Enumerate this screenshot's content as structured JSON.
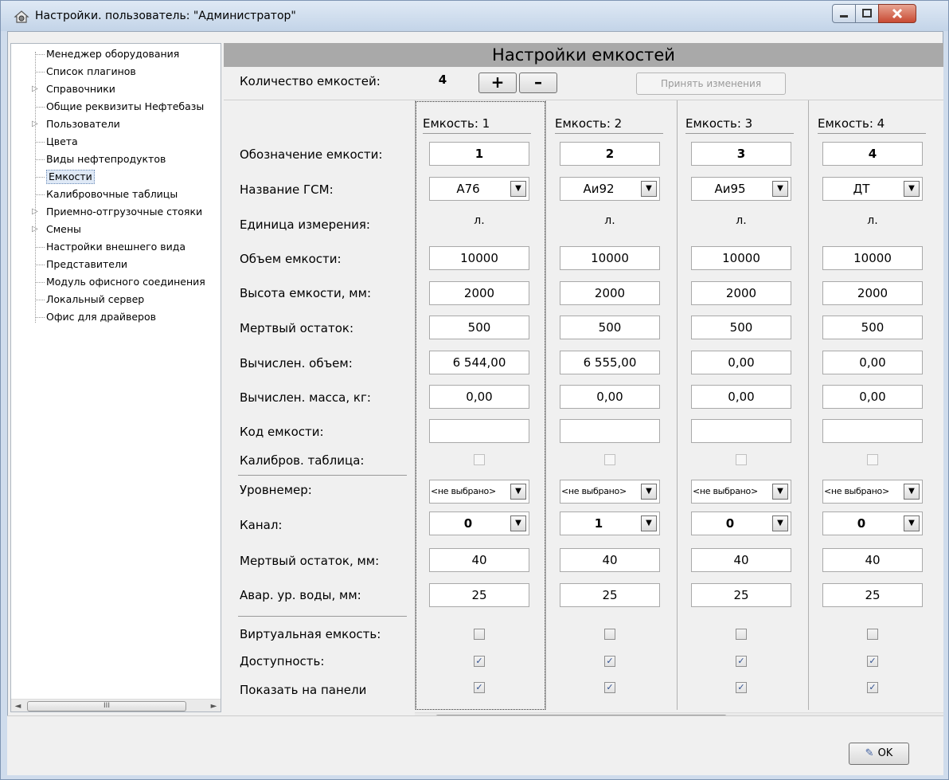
{
  "window": {
    "title": "Настройки. пользователь: \"Администратор\"",
    "app_icon": "house-gear-icon",
    "controls": {
      "minimize": "minimize-icon",
      "maximize": "maximize-icon",
      "close": "close-icon"
    }
  },
  "tree": {
    "items": [
      {
        "label": "Менеджер оборудования",
        "expandable": false
      },
      {
        "label": "Список плагинов",
        "expandable": false
      },
      {
        "label": "Справочники",
        "expandable": true
      },
      {
        "label": "Общие реквизиты Нефтебазы",
        "expandable": false
      },
      {
        "label": "Пользователи",
        "expandable": true
      },
      {
        "label": "Цвета",
        "expandable": false
      },
      {
        "label": "Виды нефтепродуктов",
        "expandable": false
      },
      {
        "label": "Емкости",
        "expandable": false,
        "selected": true
      },
      {
        "label": "Калибровочные таблицы",
        "expandable": false
      },
      {
        "label": "Приемно-отгрузочные стояки",
        "expandable": true
      },
      {
        "label": "Смены",
        "expandable": true
      },
      {
        "label": "Настройки внешнего вида",
        "expandable": false
      },
      {
        "label": "Представители",
        "expandable": false
      },
      {
        "label": "Модуль офисного соединения",
        "expandable": false
      },
      {
        "label": "Локальный сервер",
        "expandable": false
      },
      {
        "label": "Офис для драйверов",
        "expandable": false
      }
    ]
  },
  "panel": {
    "title": "Настройки емкостей",
    "count_label": "Количество емкостей:",
    "count_value": "4",
    "plus_label": "+",
    "minus_label": "–",
    "apply_label": "Принять изменения"
  },
  "labels": {
    "designation": "Обозначение емкости:",
    "fuel_name": "Название ГСМ:",
    "unit": "Единица измерения:",
    "volume": "Объем емкости:",
    "height": "Высота емкости, мм:",
    "dead_rest": "Мертвый остаток:",
    "calc_volume": "Вычислен. объем:",
    "calc_mass": "Вычислен. масса, кг:",
    "code": "Код емкости:",
    "calib_table": "Калибров. таблица:",
    "level_gauge": "Уровнемер:",
    "channel": "Канал:",
    "dead_rest_mm": "Мертвый остаток, мм:",
    "alarm_water": "Авар. ур. воды, мм:",
    "virtual": "Виртуальная емкость:",
    "available": "Доступность:",
    "show_panel": "Показать на панели"
  },
  "tanks": [
    {
      "header": "Емкость: 1",
      "designation": "1",
      "fuel": "А76",
      "unit": "л.",
      "volume": "10000",
      "height": "2000",
      "dead_rest": "500",
      "calc_volume": "6 544,00",
      "calc_mass": "0,00",
      "code": "",
      "calib": false,
      "gauge": "<не выбрано>",
      "channel": "0",
      "dead_rest_mm": "40",
      "alarm_water": "25",
      "virtual": false,
      "available": true,
      "show_panel": true
    },
    {
      "header": "Емкость: 2",
      "designation": "2",
      "fuel": "Аи92",
      "unit": "л.",
      "volume": "10000",
      "height": "2000",
      "dead_rest": "500",
      "calc_volume": "6 555,00",
      "calc_mass": "0,00",
      "code": "",
      "calib": false,
      "gauge": "<не выбрано>",
      "channel": "1",
      "dead_rest_mm": "40",
      "alarm_water": "25",
      "virtual": false,
      "available": true,
      "show_panel": true
    },
    {
      "header": "Емкость: 3",
      "designation": "3",
      "fuel": "Аи95",
      "unit": "л.",
      "volume": "10000",
      "height": "2000",
      "dead_rest": "500",
      "calc_volume": "0,00",
      "calc_mass": "0,00",
      "code": "",
      "calib": false,
      "gauge": "<не выбрано>",
      "channel": "0",
      "dead_rest_mm": "40",
      "alarm_water": "25",
      "virtual": false,
      "available": true,
      "show_panel": true
    },
    {
      "header": "Емкость: 4",
      "designation": "4",
      "fuel": "ДТ",
      "unit": "л.",
      "volume": "10000",
      "height": "2000",
      "dead_rest": "500",
      "calc_volume": "0,00",
      "calc_mass": "0,00",
      "code": "",
      "calib": false,
      "gauge": "<не выбрано>",
      "channel": "0",
      "dead_rest_mm": "40",
      "alarm_water": "25",
      "virtual": false,
      "available": true,
      "show_panel": true
    }
  ],
  "scroll": {
    "thumb_glyph": "III",
    "left_arrow": "◄",
    "right_arrow": "►"
  },
  "footer": {
    "ok_label": "OK",
    "ok_icon": "checkmark-icon"
  }
}
